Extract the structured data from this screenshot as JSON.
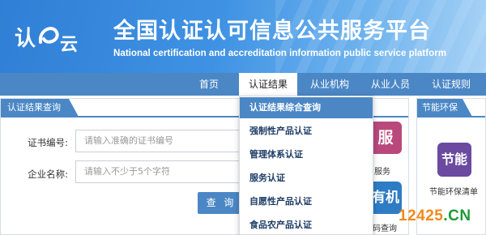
{
  "header": {
    "logo_text": "认证云",
    "title_cn": "全国认证认可信息公共服务平台",
    "title_en": "National certification and accreditation information public service platform"
  },
  "nav": {
    "items": [
      {
        "label": "首页"
      },
      {
        "label": "认证结果"
      },
      {
        "label": "从业机构"
      },
      {
        "label": "从业人员"
      },
      {
        "label": "认证规则"
      }
    ],
    "active": "认证结果"
  },
  "query_panel": {
    "tab_label": "认证结果查询",
    "cert_no_label": "证书编号:",
    "cert_no_placeholder": "请输入准确的证书编号",
    "company_label": "企业名称:",
    "company_placeholder": "请输入不少于5个字符",
    "query_button": "查 询"
  },
  "tiles": {
    "service": {
      "glyph": "服",
      "caption": "服务",
      "color": "#b9497c"
    },
    "machine": {
      "glyph": "有机",
      "caption": "机码查询",
      "color": "#2e7cc4"
    }
  },
  "eco_panel": {
    "tab_label": "节能环保",
    "tile_glyph": "节能",
    "tile_color": "#6b4aa0",
    "caption": "节能环保清单"
  },
  "dropdown": {
    "items": [
      {
        "label": "认证结果综合查询"
      },
      {
        "label": "强制性产品认证"
      },
      {
        "label": "管理体系认证"
      },
      {
        "label": "服务认证"
      },
      {
        "label": "自愿性产品认证"
      },
      {
        "label": "食品农产品认证"
      }
    ],
    "active": "认证结果综合查询"
  },
  "watermark": {
    "num": "12425",
    "dot": ".",
    "cn": "CN"
  }
}
